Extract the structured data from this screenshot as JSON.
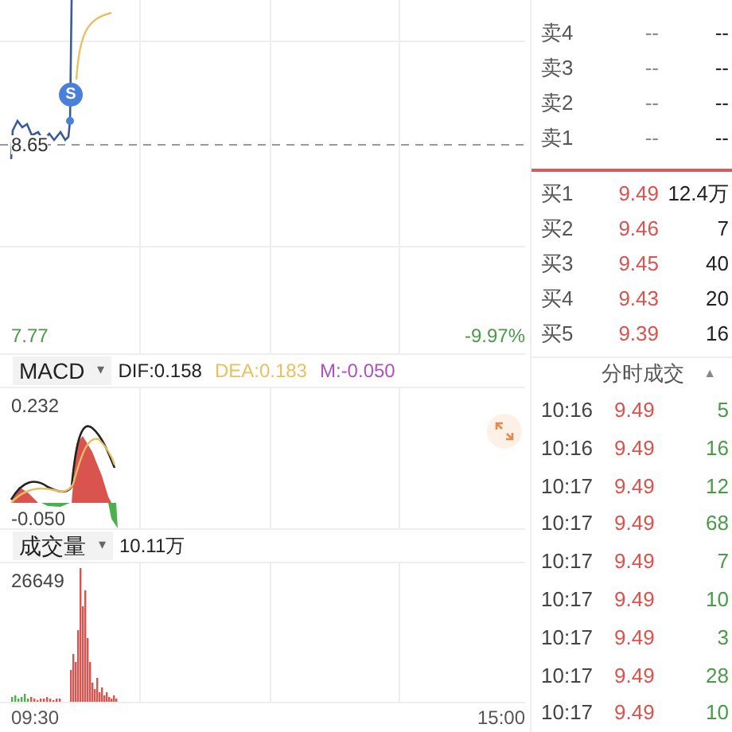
{
  "main_chart": {
    "prev_close": "8.65",
    "low_price": "7.77",
    "low_change": "-9.97%",
    "marker": "S"
  },
  "macd": {
    "indicator": "MACD",
    "caret": "▾",
    "dif": "DIF:0.158",
    "dea": "DEA:0.183",
    "m": "M:-0.050",
    "max": "0.232",
    "min": "-0.050"
  },
  "volume": {
    "indicator": "成交量",
    "caret": "▾",
    "total": "10.11万",
    "max": "26649"
  },
  "time_axis": {
    "start": "09:30",
    "end": "15:00"
  },
  "order_book": {
    "asks": [
      {
        "label": "卖4",
        "price": "--",
        "volume": "--"
      },
      {
        "label": "卖3",
        "price": "--",
        "volume": "--"
      },
      {
        "label": "卖2",
        "price": "--",
        "volume": "--"
      },
      {
        "label": "卖1",
        "price": "--",
        "volume": "--"
      }
    ],
    "bids": [
      {
        "label": "买1",
        "price": "9.49",
        "volume": "12.4万"
      },
      {
        "label": "买2",
        "price": "9.46",
        "volume": "7"
      },
      {
        "label": "买3",
        "price": "9.45",
        "volume": "40"
      },
      {
        "label": "买4",
        "price": "9.43",
        "volume": "20"
      },
      {
        "label": "买5",
        "price": "9.39",
        "volume": "16"
      }
    ]
  },
  "trades": {
    "title": "分时成交",
    "sort": "▲",
    "rows": [
      {
        "time": "10:16",
        "price": "9.49",
        "volume": "5"
      },
      {
        "time": "10:16",
        "price": "9.49",
        "volume": "16"
      },
      {
        "time": "10:17",
        "price": "9.49",
        "volume": "12"
      },
      {
        "time": "10:17",
        "price": "9.49",
        "volume": "68"
      },
      {
        "time": "10:17",
        "price": "9.49",
        "volume": "7"
      },
      {
        "time": "10:17",
        "price": "9.49",
        "volume": "10"
      },
      {
        "time": "10:17",
        "price": "9.49",
        "volume": "3"
      },
      {
        "time": "10:17",
        "price": "9.49",
        "volume": "28"
      },
      {
        "time": "10:17",
        "price": "9.49",
        "volume": "10"
      }
    ]
  }
}
